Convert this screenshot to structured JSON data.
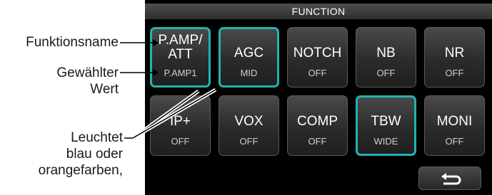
{
  "callouts": {
    "function_name": "Funktionsname",
    "selected_value_line1": "Gewählter",
    "selected_value_line2": "Wert",
    "lights_line1": "Leuchtet",
    "lights_line2": "blau oder",
    "lights_line3": "orangefarben,"
  },
  "screen": {
    "title": "FUNCTION",
    "keys": [
      {
        "name_line1": "P.AMP/",
        "name_line2": "ATT",
        "value": "P.AMP1",
        "active": true
      },
      {
        "name": "AGC",
        "value": "MID",
        "active": true
      },
      {
        "name": "NOTCH",
        "value": "OFF",
        "active": false
      },
      {
        "name": "NB",
        "value": "OFF",
        "active": false
      },
      {
        "name": "NR",
        "value": "OFF",
        "active": false
      },
      {
        "name": "IP+",
        "value": "OFF",
        "active": false
      },
      {
        "name": "VOX",
        "value": "OFF",
        "active": false
      },
      {
        "name": "COMP",
        "value": "OFF",
        "active": false
      },
      {
        "name": "TBW",
        "value": "WIDE",
        "active": true
      },
      {
        "name": "MONI",
        "value": "OFF",
        "active": false
      }
    ],
    "back_icon": "return-arrow-icon",
    "accent_color": "#22b3b0"
  }
}
